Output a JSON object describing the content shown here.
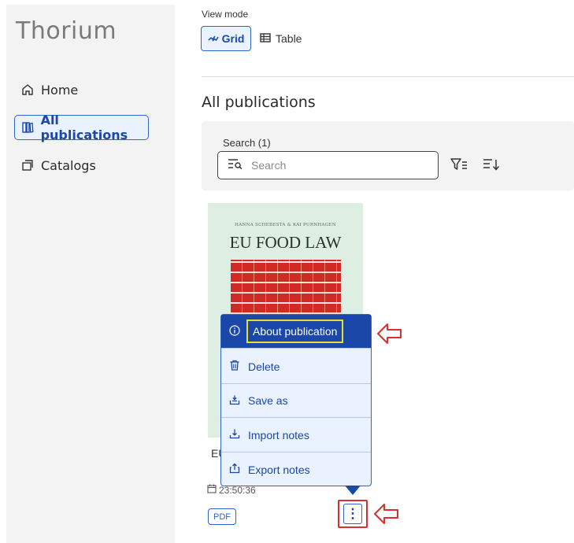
{
  "sidebar": {
    "app_title": "Thorium",
    "items": [
      {
        "label": "Home",
        "icon": "home-icon"
      },
      {
        "label": "All publications",
        "icon": "library-icon",
        "active": true
      },
      {
        "label": "Catalogs",
        "icon": "catalogs-icon"
      }
    ]
  },
  "view_mode": {
    "label": "View mode",
    "grid_label": "Grid",
    "table_label": "Table",
    "selected": "Grid"
  },
  "page_title": "All publications",
  "search": {
    "label": "Search (1)",
    "placeholder": "Search"
  },
  "publication": {
    "cover_author": "HANNA SCHEBESTA & KAI PURNHAGEN",
    "cover_title": "EU FOOD LAW",
    "title_visible": "EU",
    "time": "23:50:36",
    "format": "PDF",
    "menu_button_label": "⋮"
  },
  "context_menu": {
    "items": [
      {
        "label": "About publication",
        "icon": "info-icon"
      },
      {
        "label": "Delete",
        "icon": "trash-icon"
      },
      {
        "label": "Save as",
        "icon": "save-icon"
      },
      {
        "label": "Import notes",
        "icon": "import-icon"
      },
      {
        "label": "Export notes",
        "icon": "export-icon"
      }
    ]
  },
  "colors": {
    "accent": "#1a47a8",
    "accent_light": "#eaf1ff",
    "highlight": "#e6df2e",
    "annotation_red": "#d63031",
    "sidebar_bg": "#f3f3f3"
  }
}
